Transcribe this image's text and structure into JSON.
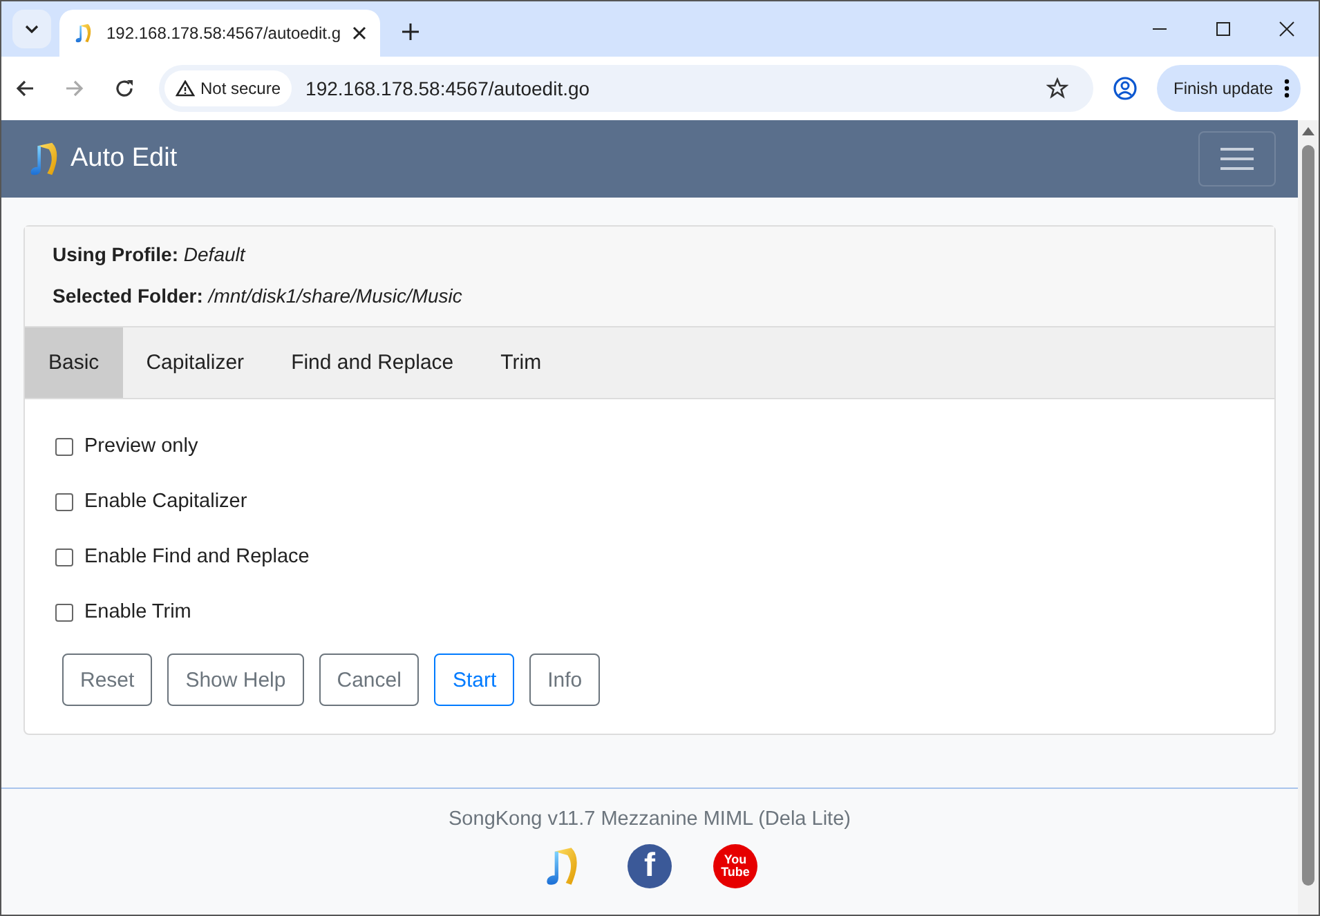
{
  "browser": {
    "tab_title": "192.168.178.58:4567/autoedit.g",
    "security": "Not secure",
    "url": "192.168.178.58:4567/autoedit.go",
    "update_button": "Finish update"
  },
  "navbar": {
    "title": "Auto Edit"
  },
  "info": [
    {
      "label": "Using Profile:",
      "value": "Default"
    },
    {
      "label": "Selected Folder:",
      "value": "/mnt/disk1/share/Music/Music"
    }
  ],
  "tabs": [
    {
      "label": "Basic",
      "selected": true
    },
    {
      "label": "Capitalizer",
      "selected": false
    },
    {
      "label": "Find and Replace",
      "selected": false
    },
    {
      "label": "Trim",
      "selected": false
    }
  ],
  "options": [
    {
      "label": "Preview only",
      "checked": false
    },
    {
      "label": "Enable Capitalizer",
      "checked": false
    },
    {
      "label": "Enable Find and Replace",
      "checked": false
    },
    {
      "label": "Enable Trim",
      "checked": false
    }
  ],
  "buttons": [
    {
      "label": "Reset",
      "kind": "secondary"
    },
    {
      "label": "Show Help",
      "kind": "secondary"
    },
    {
      "label": "Cancel",
      "kind": "secondary"
    },
    {
      "label": "Start",
      "kind": "primary"
    },
    {
      "label": "Info",
      "kind": "secondary"
    }
  ],
  "footer": {
    "version": "SongKong v11.7 Mezzanine MIML (Dela Lite)",
    "icons": [
      {
        "kind": "note"
      },
      {
        "kind": "facebook",
        "glyph": "f"
      },
      {
        "kind": "youtube",
        "lines": [
          "You",
          "Tube"
        ]
      }
    ]
  }
}
